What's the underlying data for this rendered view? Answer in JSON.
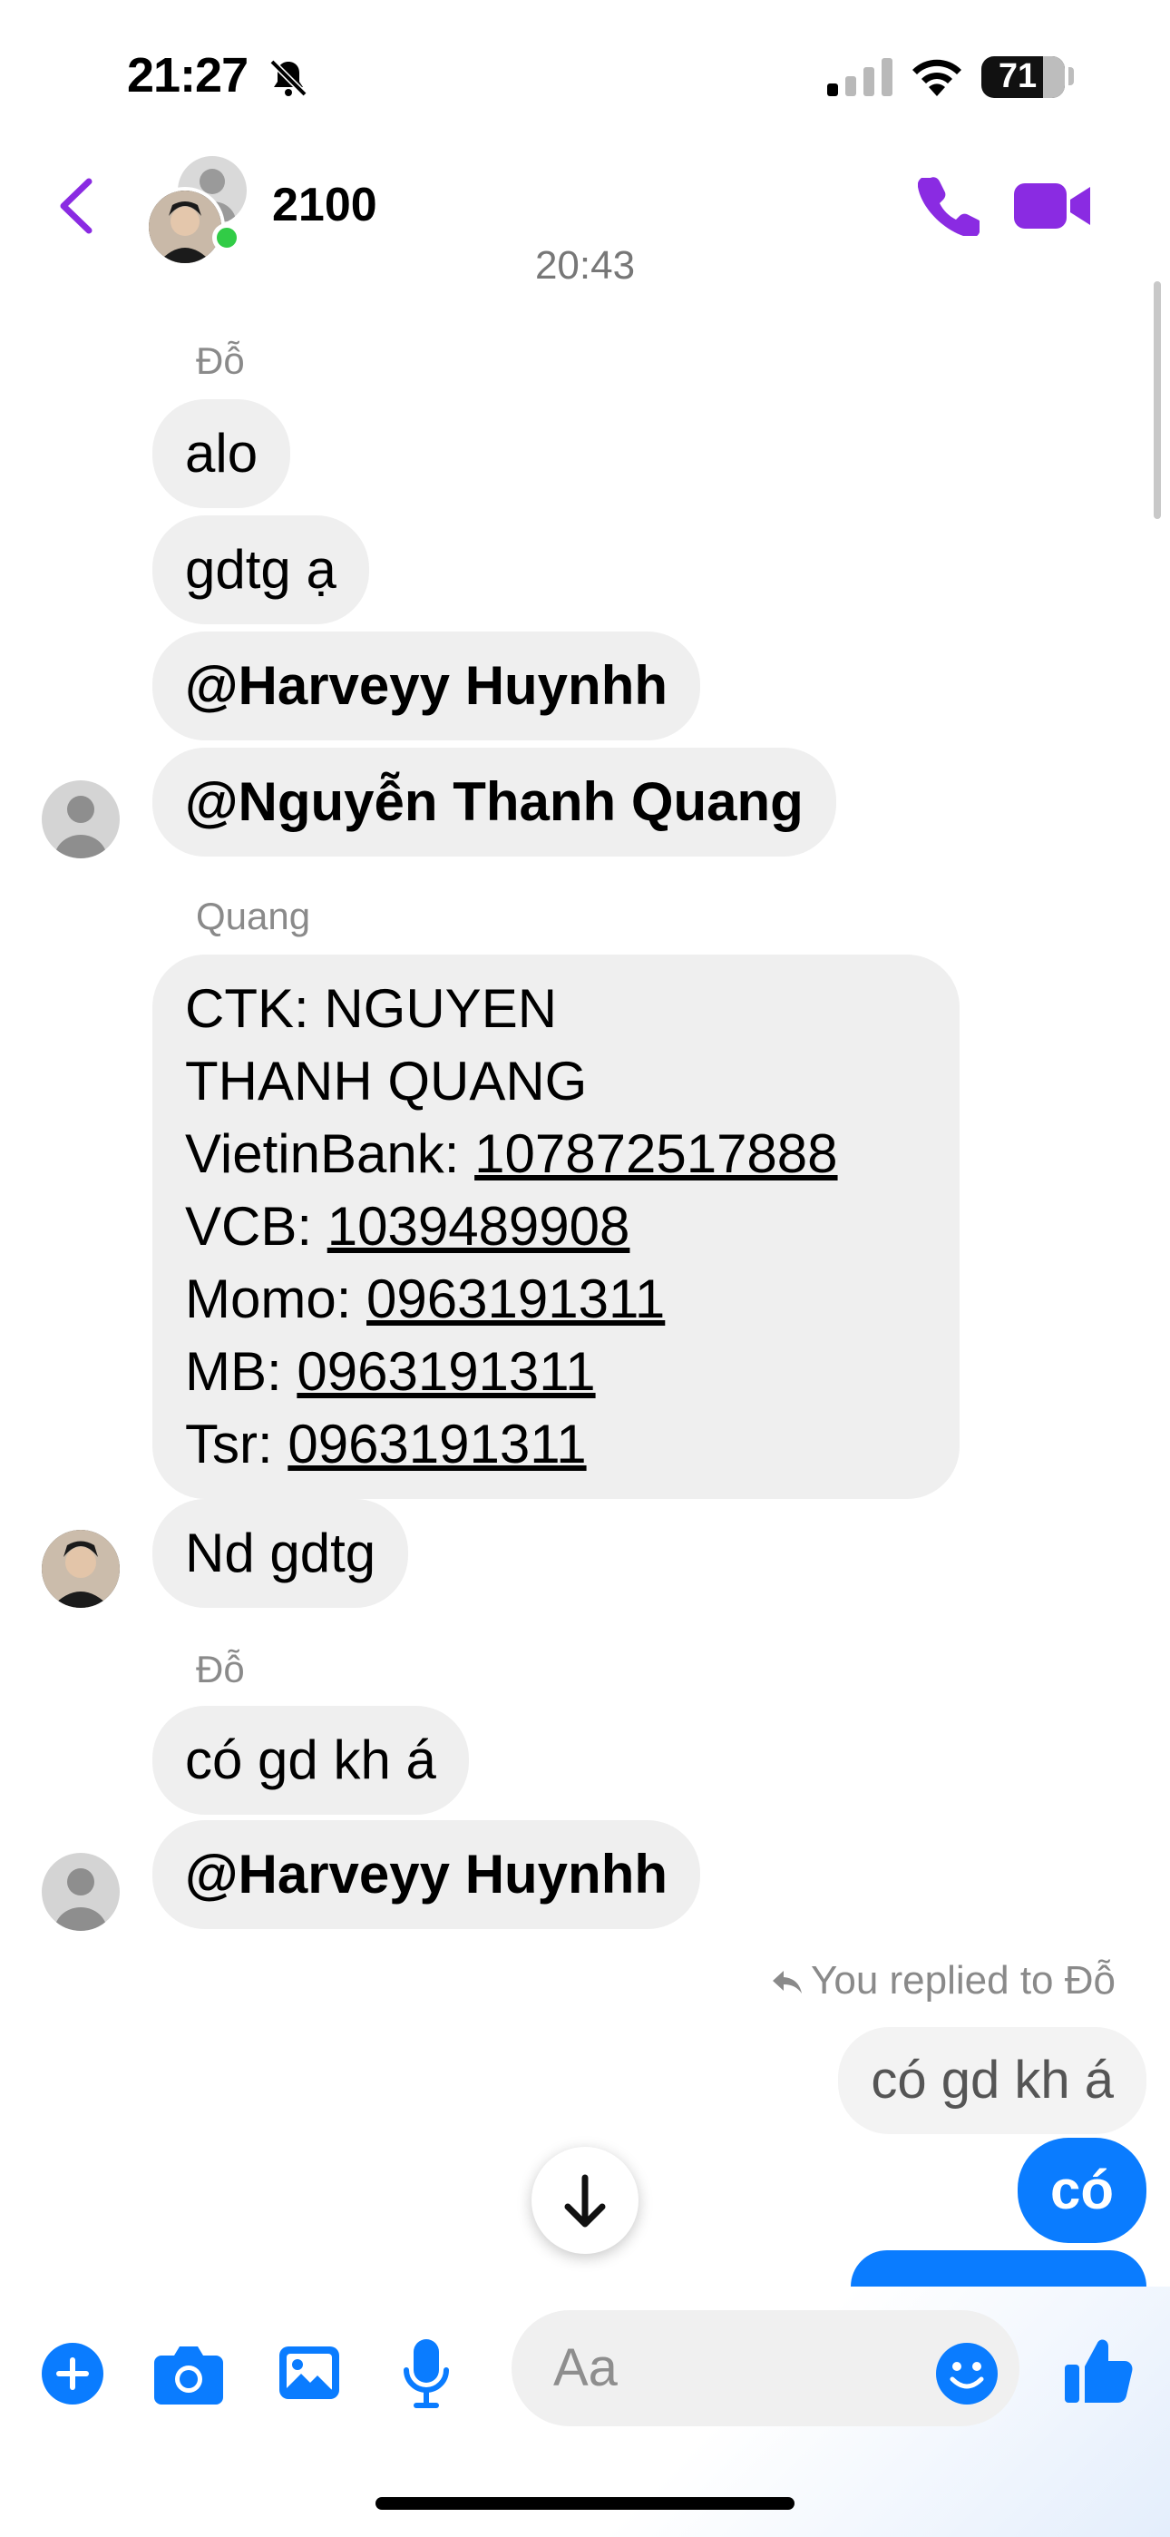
{
  "status_bar": {
    "time": "21:27",
    "battery": "71"
  },
  "header": {
    "title": "2100"
  },
  "timestamp": "20:43",
  "messages": {
    "s1_sender": "Đỗ",
    "m1": "alo",
    "m2": "gdtg ạ",
    "m3": "@Harveyy Huynhh",
    "m4": "@Nguyễn Thanh Quang",
    "s2_sender": "Quang",
    "bank": {
      "l1": "CTK: NGUYEN",
      "l2": "THANH QUANG",
      "l3_label": "VietinBank: ",
      "l3_value": "107872517888",
      "l4_label": "VCB: ",
      "l4_value": "1039489908",
      "l5_label": "Momo: ",
      "l5_value": "0963191311",
      "l6_label": "MB: ",
      "l6_value": "0963191311",
      "l7_label": "Tsr: ",
      "l7_value": "0963191311"
    },
    "m6": "Nd gdtg",
    "s3_sender": "Đỗ",
    "m7": "có gd kh á",
    "m8": "@Harveyy Huynhh",
    "reply_note": "You replied to Đỗ",
    "reply_quote": "có gd kh á",
    "out1": "có"
  },
  "composer": {
    "placeholder": "Aa"
  },
  "colors": {
    "accent": "#8a2be2",
    "outgoing": "#0a7cff",
    "online": "#31cc46"
  }
}
